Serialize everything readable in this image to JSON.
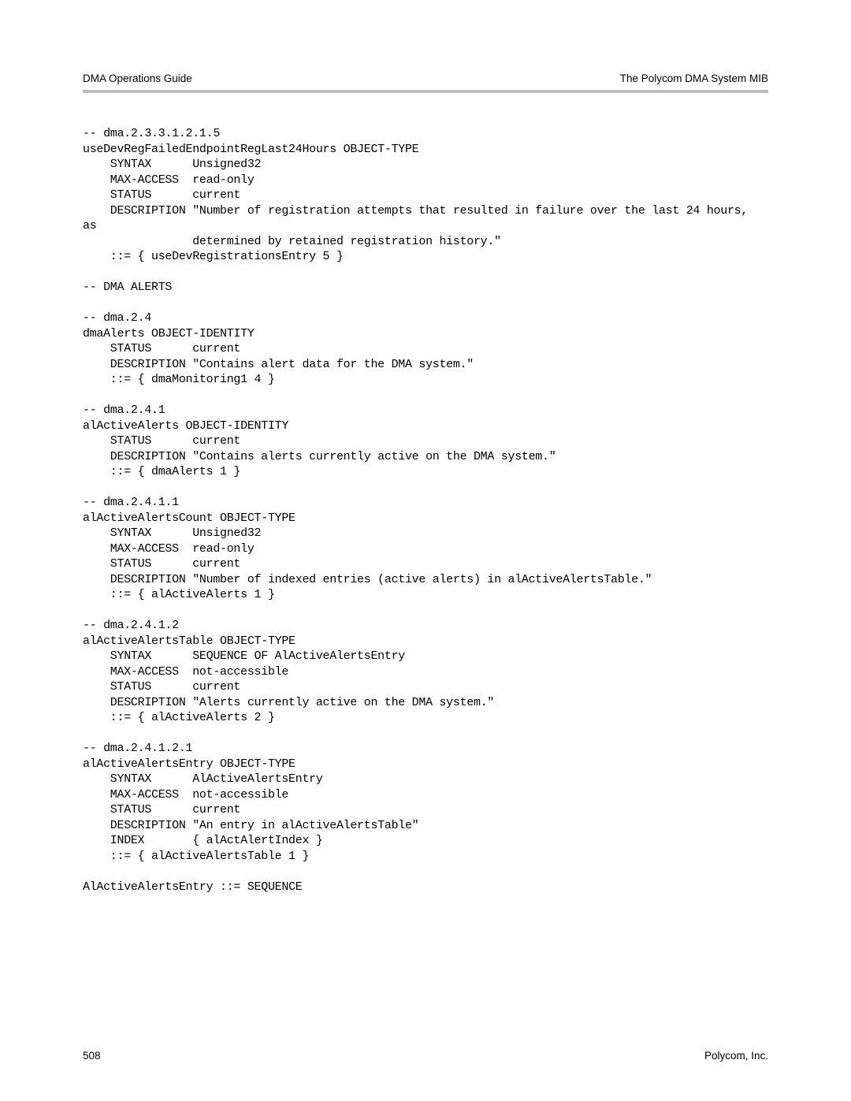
{
  "header": {
    "left": "DMA Operations Guide",
    "right": "The Polycom DMA System MIB"
  },
  "code": "-- dma.2.3.3.1.2.1.5\nuseDevRegFailedEndpointRegLast24Hours OBJECT-TYPE\n    SYNTAX      Unsigned32\n    MAX-ACCESS  read-only\n    STATUS      current\n    DESCRIPTION \"Number of registration attempts that resulted in failure over the last 24 hours, \nas \n                determined by retained registration history.\"\n    ::= { useDevRegistrationsEntry 5 }\n\n-- DMA ALERTS\n\n-- dma.2.4\ndmaAlerts OBJECT-IDENTITY\n    STATUS      current\n    DESCRIPTION \"Contains alert data for the DMA system.\"\n    ::= { dmaMonitoring1 4 }\n\n-- dma.2.4.1\nalActiveAlerts OBJECT-IDENTITY\n    STATUS      current\n    DESCRIPTION \"Contains alerts currently active on the DMA system.\"\n    ::= { dmaAlerts 1 }\n\n-- dma.2.4.1.1\nalActiveAlertsCount OBJECT-TYPE\n    SYNTAX      Unsigned32\n    MAX-ACCESS  read-only\n    STATUS      current\n    DESCRIPTION \"Number of indexed entries (active alerts) in alActiveAlertsTable.\"\n    ::= { alActiveAlerts 1 }\n\n-- dma.2.4.1.2\nalActiveAlertsTable OBJECT-TYPE\n    SYNTAX      SEQUENCE OF AlActiveAlertsEntry\n    MAX-ACCESS  not-accessible\n    STATUS      current\n    DESCRIPTION \"Alerts currently active on the DMA system.\"\n    ::= { alActiveAlerts 2 }\n\n-- dma.2.4.1.2.1\nalActiveAlertsEntry OBJECT-TYPE\n    SYNTAX      AlActiveAlertsEntry\n    MAX-ACCESS  not-accessible\n    STATUS      current\n    DESCRIPTION \"An entry in alActiveAlertsTable\"\n    INDEX       { alActAlertIndex }\n    ::= { alActiveAlertsTable 1 }\n\nAlActiveAlertsEntry ::= SEQUENCE",
  "footer": {
    "page": "508",
    "company": "Polycom, Inc."
  }
}
